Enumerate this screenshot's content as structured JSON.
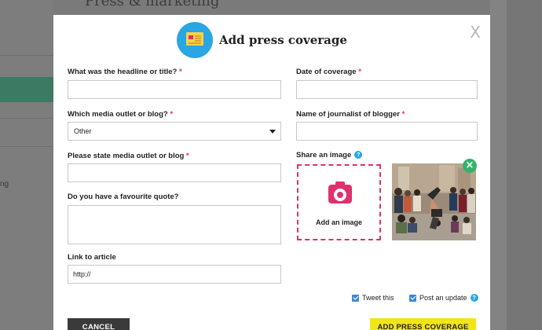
{
  "background": {
    "page_title": "Press & marketing",
    "sidebar_fragment": "ng"
  },
  "modal": {
    "title": "Add press coverage",
    "close_label": "X",
    "headline": {
      "label": "What was the headline or title?",
      "required": "*",
      "value": ""
    },
    "media_outlet": {
      "label": "Which media outlet or blog?",
      "required": "*",
      "selected": "Other"
    },
    "state_outlet": {
      "label": "Please state media outlet or blog",
      "required": "*",
      "value": ""
    },
    "quote": {
      "label": "Do you have a favourite quote?",
      "value": ""
    },
    "link": {
      "label": "Link to article",
      "value": "http://"
    },
    "date": {
      "label": "Date of coverage",
      "required": "*",
      "value": ""
    },
    "journalist": {
      "label": "Name of journalist of blogger",
      "required": "*",
      "value": ""
    },
    "image": {
      "label": "Share an image",
      "help": "?",
      "add_label": "Add an image",
      "remove_label": "×"
    },
    "tweet": {
      "label": "Tweet this",
      "checked": true
    },
    "update": {
      "label": "Post an update",
      "help": "?",
      "checked": true
    },
    "cancel_label": "CANCEL",
    "submit_label": "ADD PRESS COVERAGE"
  },
  "colors": {
    "accent_pink": "#e0306e",
    "help_blue": "#2aa6e2",
    "submit_yellow": "#f2e516",
    "remove_green": "#35b36b"
  }
}
